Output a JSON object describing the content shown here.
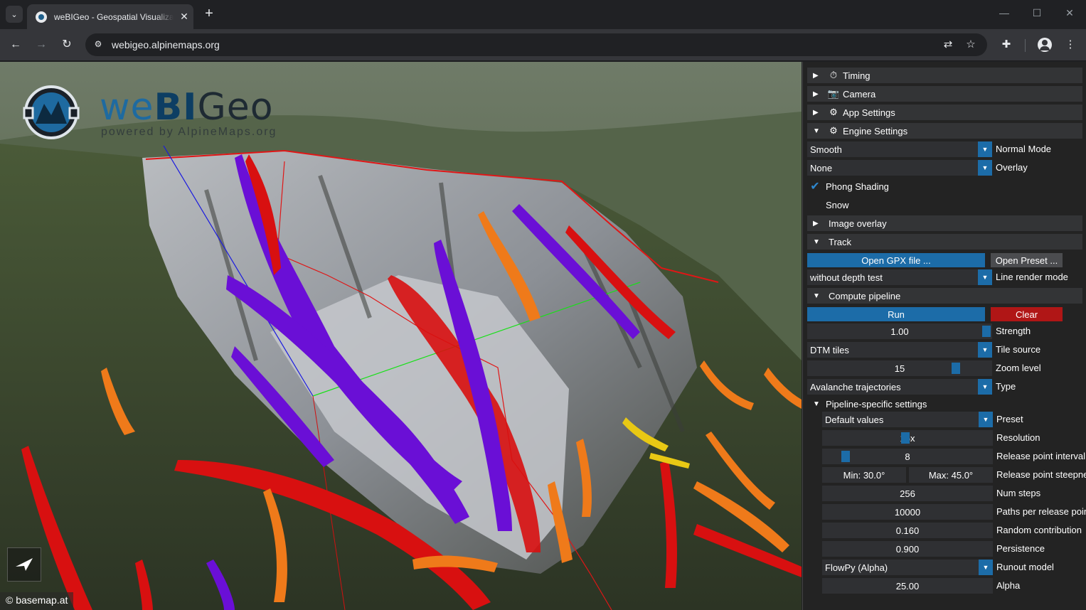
{
  "browser": {
    "tab_title": "weBIGeo - Geospatial Visualization",
    "tab_close": "✕",
    "new_tab": "+",
    "url": "webigeo.alpinemaps.org",
    "window": {
      "minimize": "—",
      "maximize": "☐",
      "close": "✕"
    }
  },
  "app": {
    "brand": {
      "we": "we",
      "bi": "BI",
      "geo": "Geo",
      "powered": "powered by AlpineMaps.org"
    },
    "attribution": "© basemap.at"
  },
  "panel": {
    "headers": {
      "timing": "Timing",
      "camera": "Camera",
      "app_settings": "App Settings",
      "engine_settings": "Engine Settings",
      "image_overlay": "Image overlay",
      "track": "Track",
      "compute_pipeline": "Compute pipeline",
      "pipeline_specific": "Pipeline-specific settings"
    },
    "engine": {
      "normal_mode": {
        "value": "Smooth",
        "label": "Normal Mode"
      },
      "overlay": {
        "value": "None",
        "label": "Overlay"
      },
      "phong_shading": {
        "label": "Phong Shading",
        "checked": true
      },
      "snow": {
        "label": "Snow",
        "checked": false
      }
    },
    "track": {
      "open_gpx": "Open GPX file ...",
      "open_preset": "Open Preset ...",
      "line_render_mode": {
        "value": "without depth test",
        "label": "Line render mode"
      }
    },
    "compute": {
      "run": "Run",
      "clear": "Clear",
      "strength": {
        "value": "1.00",
        "label": "Strength",
        "level": 1.0
      },
      "tile_source": {
        "value": "DTM tiles",
        "label": "Tile source"
      },
      "zoom_level": {
        "value": "15",
        "label": "Zoom level",
        "level": 0.82
      },
      "type": {
        "value": "Avalanche trajectories",
        "label": "Type"
      }
    },
    "pipeline": {
      "preset": {
        "value": "Default values",
        "label": "Preset"
      },
      "resolution": {
        "value": "16x",
        "label": "Resolution"
      },
      "release_interval": {
        "value": "8",
        "label": "Release point interval"
      },
      "release_steepness": {
        "min": "Min: 30.0°",
        "max": "Max: 45.0°",
        "label": "Release point steepness"
      },
      "num_steps": {
        "value": "256",
        "label": "Num steps"
      },
      "paths_per_release": {
        "value": "10000",
        "label": "Paths per release point"
      },
      "random_contribution": {
        "value": "0.160",
        "label": "Random contribution"
      },
      "persistence": {
        "value": "0.900",
        "label": "Persistence"
      },
      "runout_model": {
        "value": "FlowPy (Alpha)",
        "label": "Runout model"
      },
      "alpha": {
        "value": "25.00",
        "label": "Alpha"
      }
    }
  },
  "colors": {
    "accent_blue": "#1c6ca8",
    "clear_red": "#b01616",
    "trajectory_purple": "#6a0fd6",
    "trajectory_red": "#d81010",
    "trajectory_orange": "#ef7a1a",
    "trajectory_yellow": "#e8c814"
  },
  "icons": {
    "collapsed": "▶",
    "expanded": "▼",
    "dropdown": "▼",
    "timing": "stopwatch-icon",
    "camera": "camera-icon",
    "app_settings": "gear-icon",
    "engine_settings": "gears-icon",
    "check": "✔"
  }
}
